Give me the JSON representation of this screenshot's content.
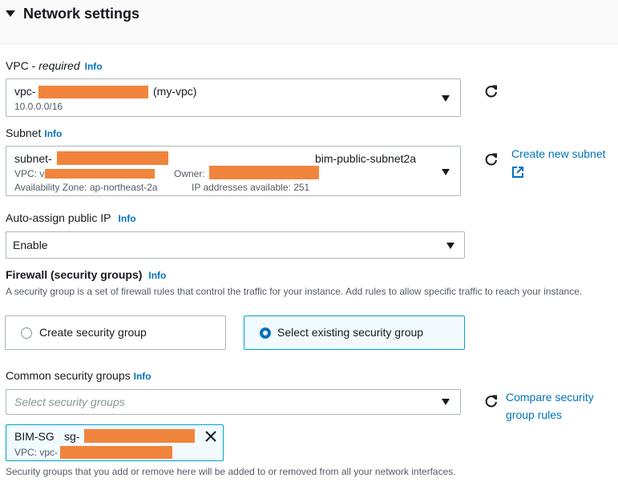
{
  "section": {
    "title": "Network settings"
  },
  "vpc": {
    "label": "VPC - ",
    "required": "required",
    "info": "Info",
    "value_prefix": "vpc-",
    "value_name": "(my-vpc)",
    "cidr": "10.0.0.0/16"
  },
  "subnet": {
    "label": "Subnet",
    "info": "Info",
    "value_prefix": "subnet-",
    "value_name": "bim-public-subnet2a",
    "vpc_prefix": "VPC: v",
    "owner_label": "Owner:",
    "az": "Availability Zone: ap-northeast-2a",
    "ips": "IP addresses available: 251",
    "create_link": "Create new subnet"
  },
  "auto_ip": {
    "label": "Auto-assign public IP",
    "info": "Info",
    "value": "Enable"
  },
  "firewall": {
    "label": "Firewall (security groups)",
    "info": "Info",
    "description": "A security group is a set of firewall rules that control the traffic for your instance. Add rules to allow specific traffic to reach your instance.",
    "options": [
      "Create security group",
      "Select existing security group"
    ],
    "selected": "Select existing security group"
  },
  "common_sg": {
    "label": "Common security groups",
    "info": "Info",
    "placeholder": "Select security groups",
    "compare_link_line1": "Compare security",
    "compare_link_line2": "group rules"
  },
  "token": {
    "name": "BIM-SG",
    "id_prefix": "sg-",
    "vpc_prefix": "VPC: vpc-"
  },
  "footer_note": "Security groups that you add or remove here will be added to or removed from all your network interfaces.",
  "colors": {
    "link": "#0073bb",
    "selected_bg": "#f1faff",
    "redaction": "#f0843c"
  }
}
